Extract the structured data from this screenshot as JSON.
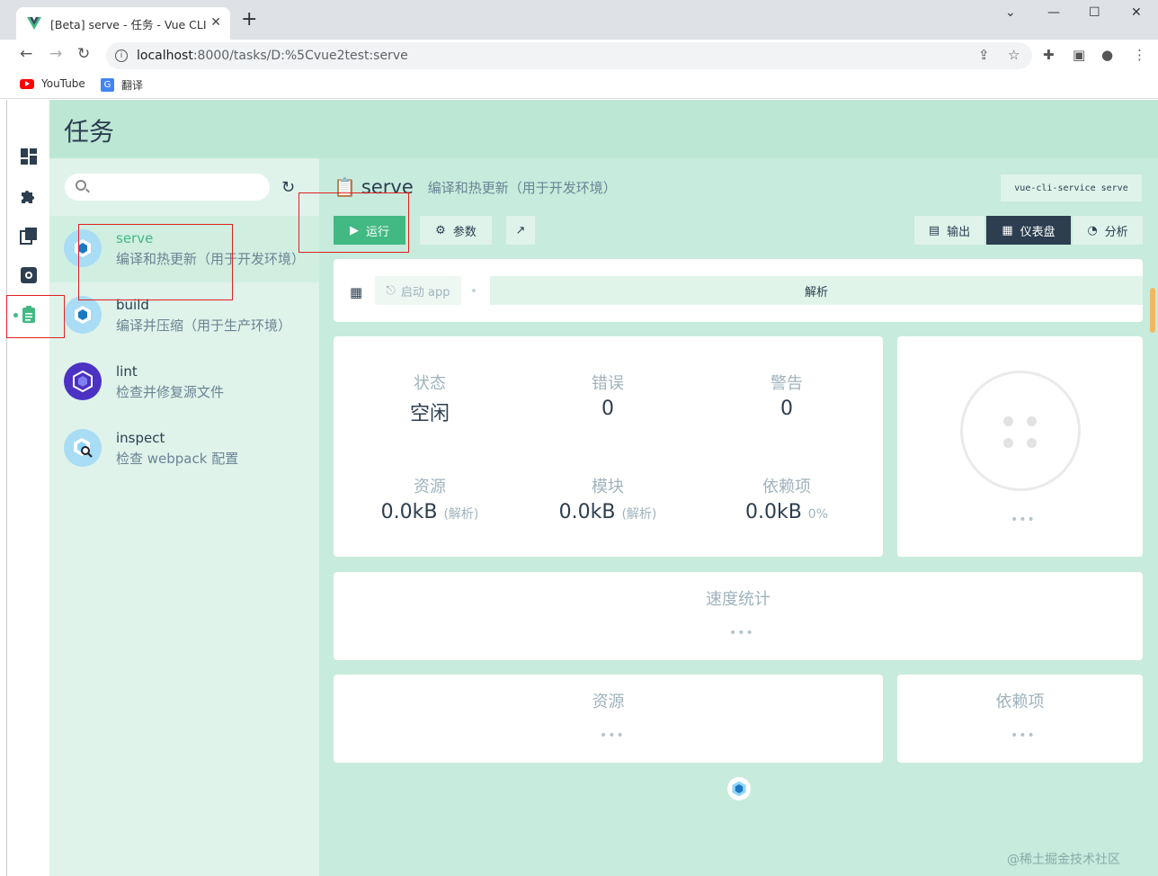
{
  "browser": {
    "tab_title": "[Beta] serve - 任务 - Vue CLI",
    "url_host": "localhost",
    "url_rest": ":8000/tasks/D:%5Cvue2test:serve",
    "bookmarks": [
      {
        "label": "YouTube",
        "icon": "youtube-icon"
      },
      {
        "label": "翻译",
        "icon": "translate-icon"
      }
    ]
  },
  "page": {
    "title": "任务"
  },
  "sidebar": {
    "items": [
      {
        "name": "dashboard",
        "icon": "dashboard-icon"
      },
      {
        "name": "plugins",
        "icon": "puzzle-icon"
      },
      {
        "name": "dependencies",
        "icon": "library-icon"
      },
      {
        "name": "configuration",
        "icon": "gear-icon"
      },
      {
        "name": "tasks",
        "icon": "clipboard-icon",
        "active": true
      }
    ]
  },
  "tasks": {
    "search_placeholder": "",
    "items": [
      {
        "name": "serve",
        "desc": "编译和热更新（用于开发环境）",
        "selected": true
      },
      {
        "name": "build",
        "desc": "编译并压缩（用于生产环境）"
      },
      {
        "name": "lint",
        "desc": "检查并修复源文件"
      },
      {
        "name": "inspect",
        "desc": "检查 webpack 配置"
      }
    ]
  },
  "detail": {
    "task_name": "serve",
    "task_desc": "编译和热更新（用于开发环境）",
    "command": "vue-cli-service serve",
    "buttons": {
      "run": "运行",
      "params": "参数",
      "output": "输出",
      "dashboard": "仪表盘",
      "analyze": "分析"
    },
    "bar": {
      "launch_app": "启动 app",
      "analyze": "解析"
    },
    "stats": {
      "status_label": "状态",
      "status_value": "空闲",
      "errors_label": "错误",
      "errors_value": "0",
      "warnings_label": "警告",
      "warnings_value": "0",
      "assets_label": "资源",
      "assets_value": "0.0kB",
      "assets_sub": "(解析)",
      "modules_label": "模块",
      "modules_value": "0.0kB",
      "modules_sub": "(解析)",
      "deps_label": "依赖项",
      "deps_value": "0.0kB",
      "deps_sub": "0%"
    },
    "ellipsis": "•••",
    "cards": {
      "speed": "速度统计",
      "assets": "资源",
      "deps": "依赖项"
    }
  },
  "watermark": "@稀土掘金技术社区",
  "colors": {
    "accent": "#42b983",
    "dark": "#2c3e50",
    "bg": "#c7ebdc",
    "highlight_box": "#e02020"
  }
}
